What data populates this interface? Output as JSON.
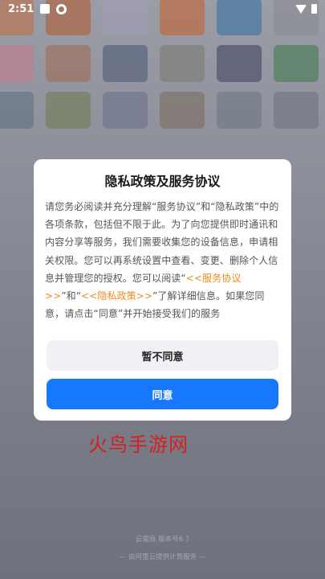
{
  "status_bar": {
    "time": "2:51",
    "icons": [
      "notification-box-icon",
      "settings-gear-icon",
      "wifi-icon",
      "battery-icon"
    ]
  },
  "dialog": {
    "title": "隐私政策及服务协议",
    "body_parts": [
      "请您务必阅读并充分理解“服务协议”和“隐私政策”中的各项条款，包括但不限于此。为了向您提供即时通讯和内容分享等服务，我们需要收集您的设备信息，申请相关权限。您可以再系统设置中查看、变更、删除个人信息并管理您的授权。您可以阅读“",
      "<<服务协议>>",
      "”和“",
      "<<隐私政策>>",
      "”了解详细信息。如果您同意，请点击“同意”并开始接受我们的服务"
    ],
    "decline_label": "暂不同意",
    "agree_label": "同意"
  },
  "watermark": "火鸟手游网",
  "footer": {
    "version_text": "云電竞  版本号6.7",
    "provider_text": "— 由阿里云提供计算服务 —"
  },
  "colors": {
    "accent": "#1677ff",
    "link": "#f08a1e",
    "watermark": "#d42020"
  }
}
